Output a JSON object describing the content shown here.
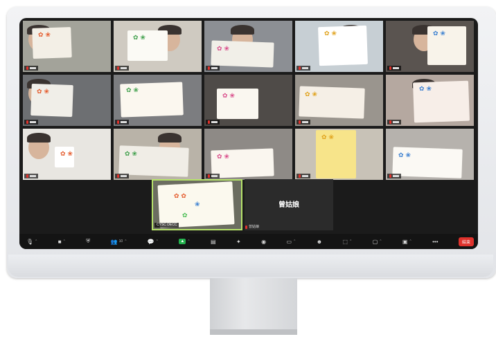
{
  "meeting": {
    "active_speaker": {
      "tag": "CYSC DECC"
    },
    "name_tile": {
      "display_name": "曾姑娘",
      "tag": "曾姑娘"
    }
  },
  "tiles": [
    {
      "bg": "#a3a39a",
      "card": "#f3efe6",
      "face": true
    },
    {
      "bg": "#cfcac1",
      "card": "#fbfaf5",
      "face": true
    },
    {
      "bg": "#8c8f94",
      "card": "#f1efe8",
      "face": true
    },
    {
      "bg": "#c7cfd4",
      "card": "#ffffff",
      "face": true
    },
    {
      "bg": "#5a5450",
      "card": "#f8f3ea",
      "face": true
    },
    {
      "bg": "#6d6f72",
      "card": "#f0eee8",
      "face": true
    },
    {
      "bg": "#7c7d80",
      "card": "#fbf7ef",
      "face": false
    },
    {
      "bg": "#4f4b48",
      "card": "#faf7f0",
      "face": false
    },
    {
      "bg": "#9a958e",
      "card": "#f5efe6",
      "face": false
    },
    {
      "bg": "#b5a8a0",
      "card": "#f7eee8",
      "face": true
    },
    {
      "bg": "#e8e6e1",
      "card": "#ffffff",
      "face": true
    },
    {
      "bg": "#b9b3a8",
      "card": "#f0ede6",
      "face": true
    },
    {
      "bg": "#8e8a86",
      "card": "#faf6ef",
      "face": false
    },
    {
      "bg": "#c8c2b7",
      "card": "#f7e48a",
      "face": false
    },
    {
      "bg": "#b6b2ad",
      "card": "#fbf9f4",
      "face": false
    }
  ],
  "toolbar": {
    "participants_count": "10",
    "end_label": "結束"
  },
  "icons": {
    "mic": "microphone-icon",
    "video": "video-camera-icon",
    "security": "shield-icon",
    "participants": "participants-icon",
    "chat": "chat-icon",
    "share": "share-screen-icon",
    "record": "record-icon",
    "reactions": "sparkle-icon",
    "more": "more-icon"
  },
  "colors": {
    "accent_border": "#b6e36a",
    "end_red": "#e0322c",
    "share_green": "#23b14d"
  }
}
